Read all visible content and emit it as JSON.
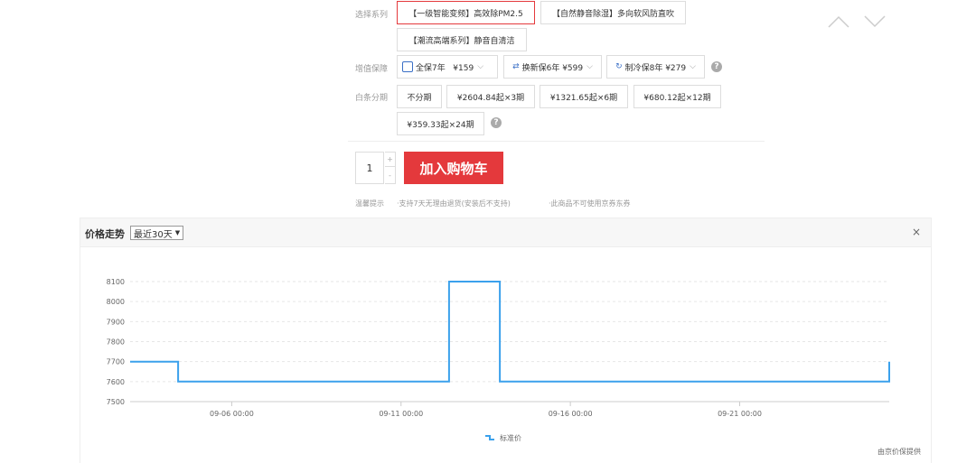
{
  "product": {
    "series_label": "选择系列",
    "series_options": [
      "【一级智能变频】高效除PM2.5",
      "【自然静音除湿】多向软风防直吹",
      "【潮流高端系列】静音自清洁"
    ],
    "warranty_label": "增值保障",
    "warranty_options": [
      "全保7年   ¥159",
      "换新保6年 ¥599",
      "制冷保8年 ¥279"
    ],
    "installment_label": "白条分期",
    "installment_options": [
      "不分期",
      "¥2604.84起×3期",
      "¥1321.65起×6期",
      "¥680.12起×12期",
      "¥359.33起×24期"
    ],
    "quantity": "1",
    "stepper_up": "+",
    "stepper_down": "-",
    "add_to_cart": "加入购物车",
    "tips_label": "温馨提示",
    "tips": [
      "·支持7天无理由退货(安装后不支持)",
      "·此商品不可使用京券东券"
    ]
  },
  "price_panel": {
    "title": "价格走势",
    "range": "最近30天",
    "close": "×",
    "credit": "由京价保提供"
  },
  "chart_data": {
    "type": "line",
    "step": true,
    "x": [
      "2023-09-03 00:00",
      "2023-09-04 10:00",
      "2023-09-04 10:00",
      "2023-09-12 10:00",
      "2023-09-12 10:00",
      "2023-09-13 22:00",
      "2023-09-13 22:00",
      "2023-09-25 10:00",
      "2023-09-25 10:00"
    ],
    "x_labels": [
      "09-06 00:00",
      "09-11 00:00",
      "09-16 00:00",
      "09-21 00:00"
    ],
    "series": [
      {
        "name": "标准价",
        "values": [
          7700,
          7700,
          7600,
          7600,
          8100,
          8100,
          7600,
          7600,
          7700
        ],
        "color": "#3ba1ec"
      }
    ],
    "y_ticks": [
      7500,
      7600,
      7700,
      7800,
      7900,
      8000,
      8100
    ],
    "ylim": [
      7500,
      8100
    ],
    "grid": true,
    "legend": "bottom-center"
  }
}
